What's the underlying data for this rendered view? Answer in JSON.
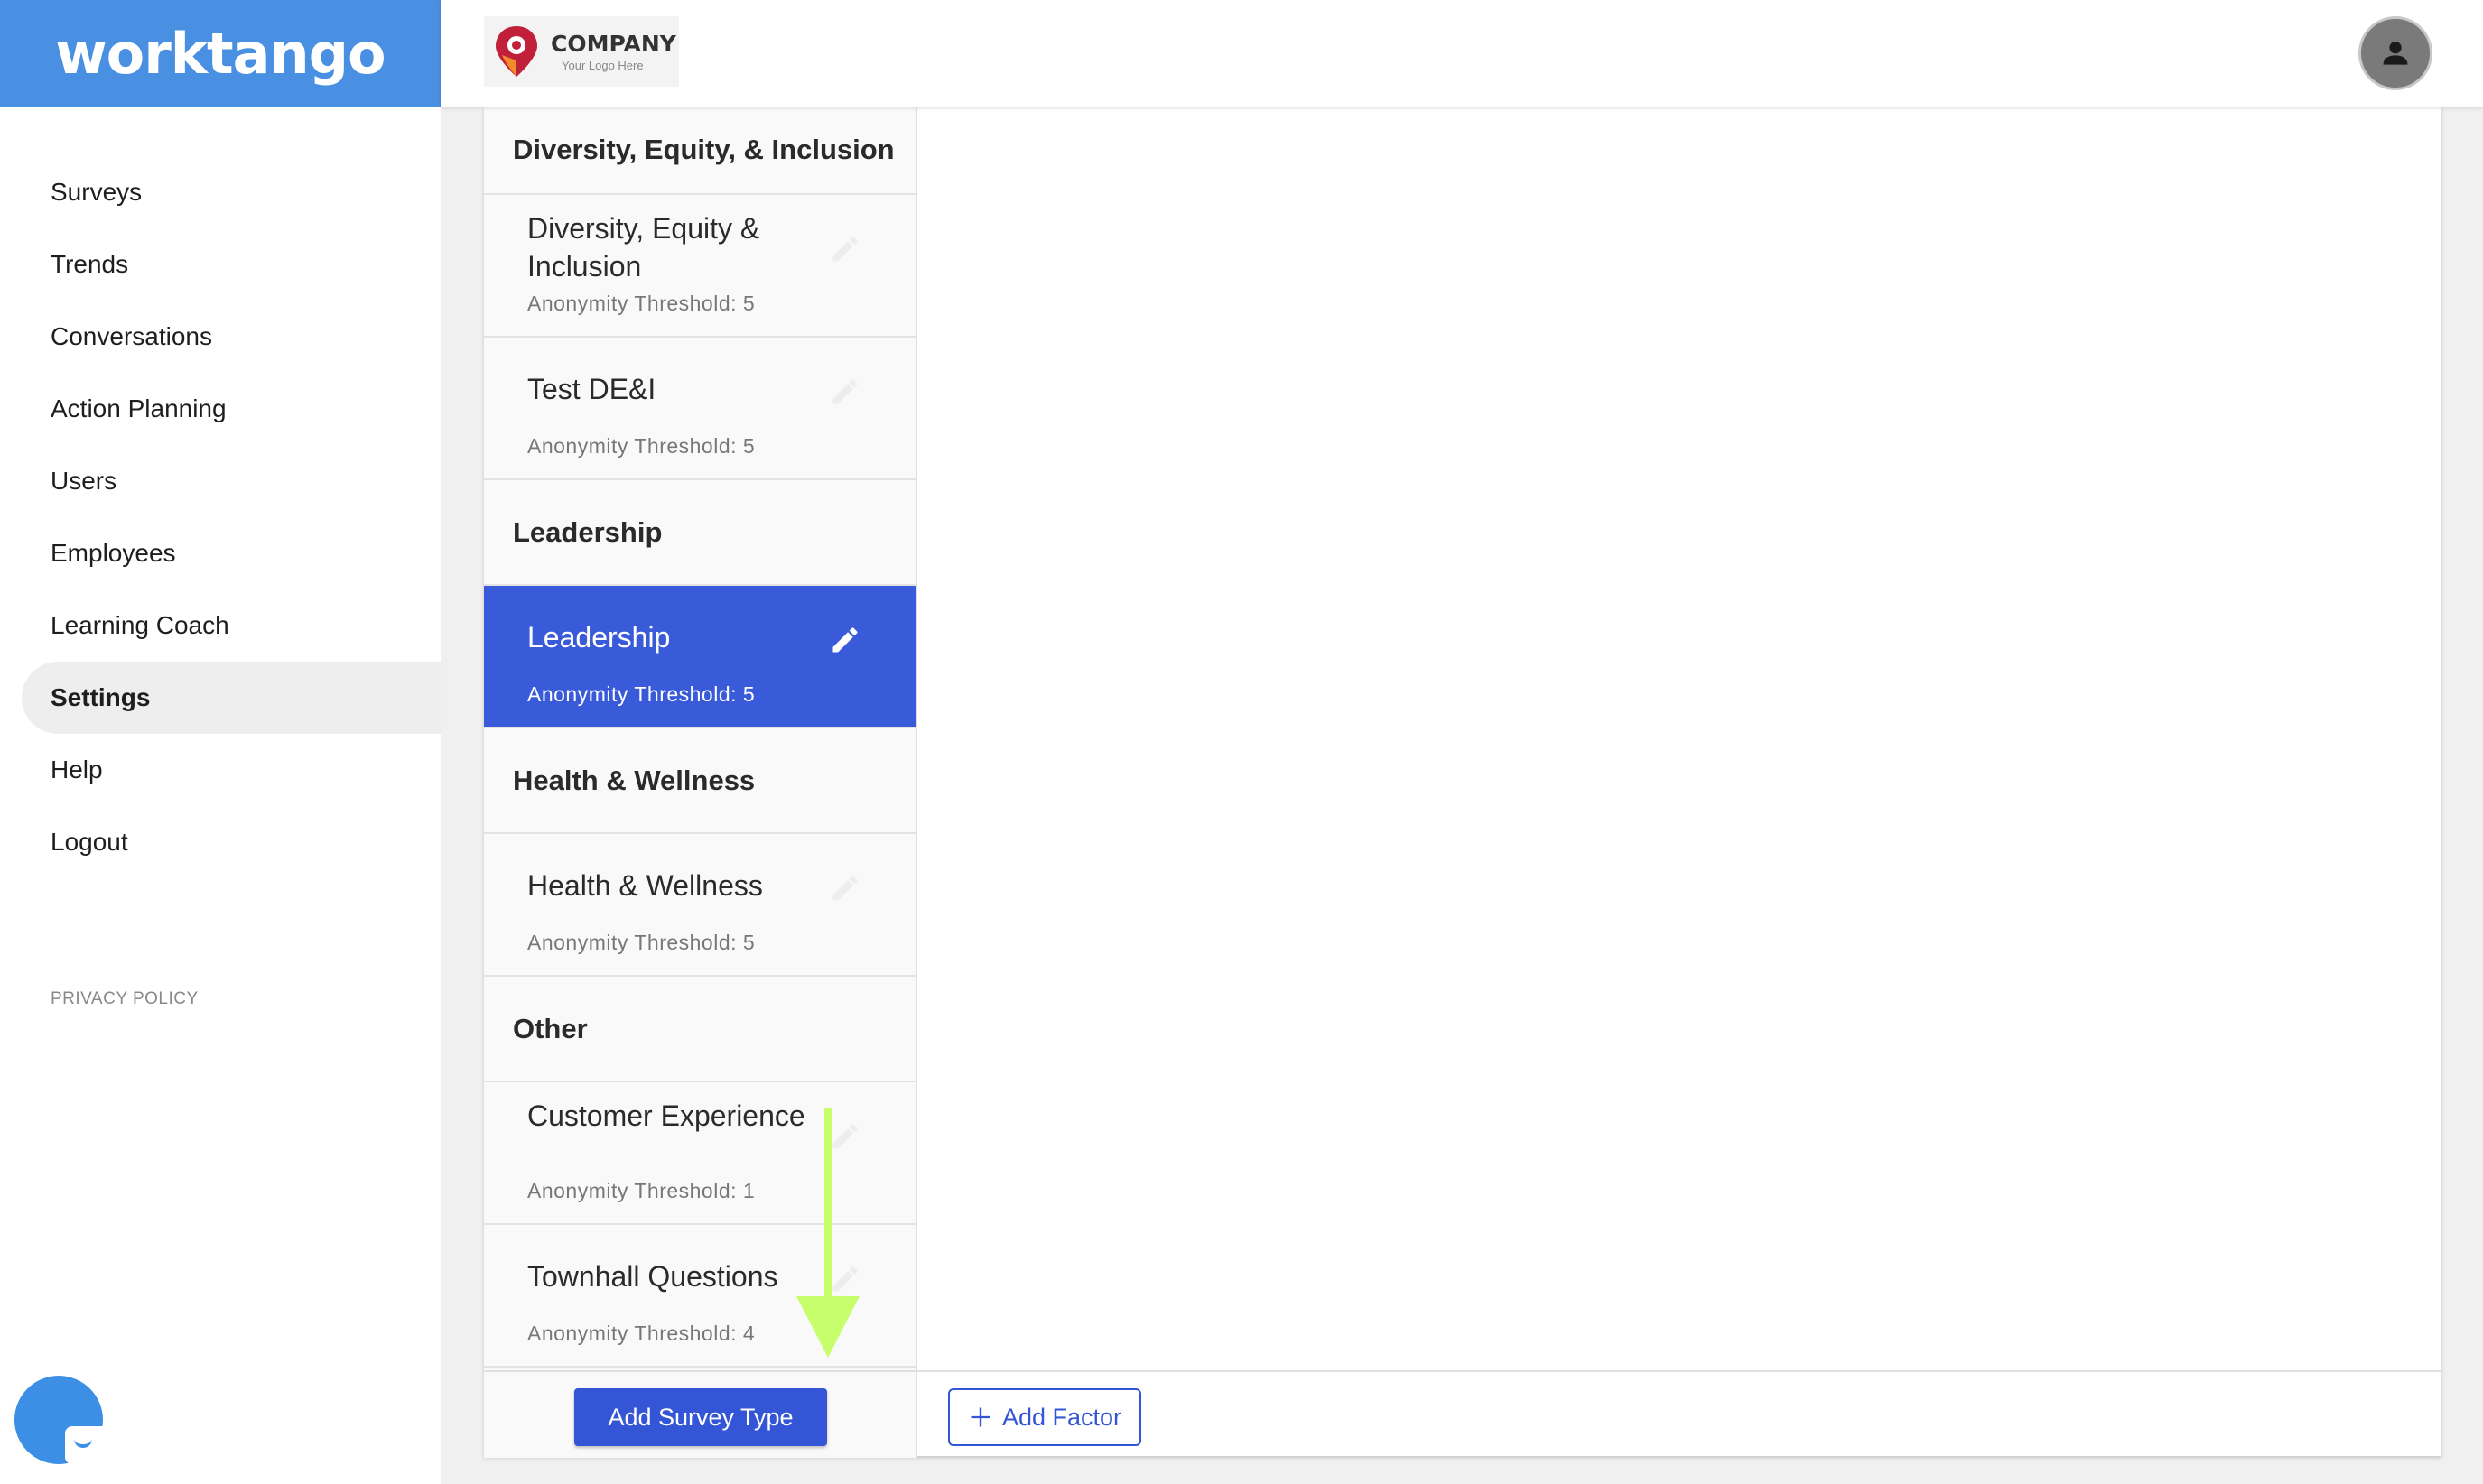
{
  "brand": {
    "name": "worktango",
    "color": "#4a90e2"
  },
  "nav": {
    "items": [
      "Surveys",
      "Trends",
      "Conversations",
      "Action Planning",
      "Users",
      "Employees",
      "Learning Coach",
      "Settings",
      "Help",
      "Logout"
    ],
    "active": "Settings",
    "privacy": "PRIVACY POLICY"
  },
  "header": {
    "logo_title": "COMPANY",
    "logo_sub": "Your Logo Here",
    "avatar_icon": "user-icon"
  },
  "survey_types": {
    "threshold_label": "Anonymity Threshold:",
    "groups": [
      {
        "title": "Diversity, Equity, & Inclusion",
        "items": [
          {
            "name": "Diversity, Equity & Inclusion",
            "threshold": "Anonymity Threshold: 5"
          },
          {
            "name": "Test DE&I",
            "threshold": "Anonymity Threshold: 5"
          }
        ]
      },
      {
        "title": "Leadership",
        "items": [
          {
            "name": "Leadership",
            "threshold": "Anonymity Threshold: 5",
            "selected": true
          }
        ]
      },
      {
        "title": "Health & Wellness",
        "items": [
          {
            "name": "Health & Wellness",
            "threshold": "Anonymity Threshold: 5"
          }
        ]
      },
      {
        "title": "Other",
        "items": [
          {
            "name": "Customer Experience",
            "threshold": "Anonymity Threshold: 1"
          },
          {
            "name": "Townhall Questions",
            "threshold": "Anonymity Threshold: 4"
          }
        ]
      }
    ]
  },
  "actions": {
    "add_survey_type": "Add Survey Type",
    "add_factor": "Add Factor"
  },
  "colors": {
    "accent": "#3355d6",
    "selected": "#3a5bd9",
    "annotation_arrow": "#c6ff6b"
  }
}
